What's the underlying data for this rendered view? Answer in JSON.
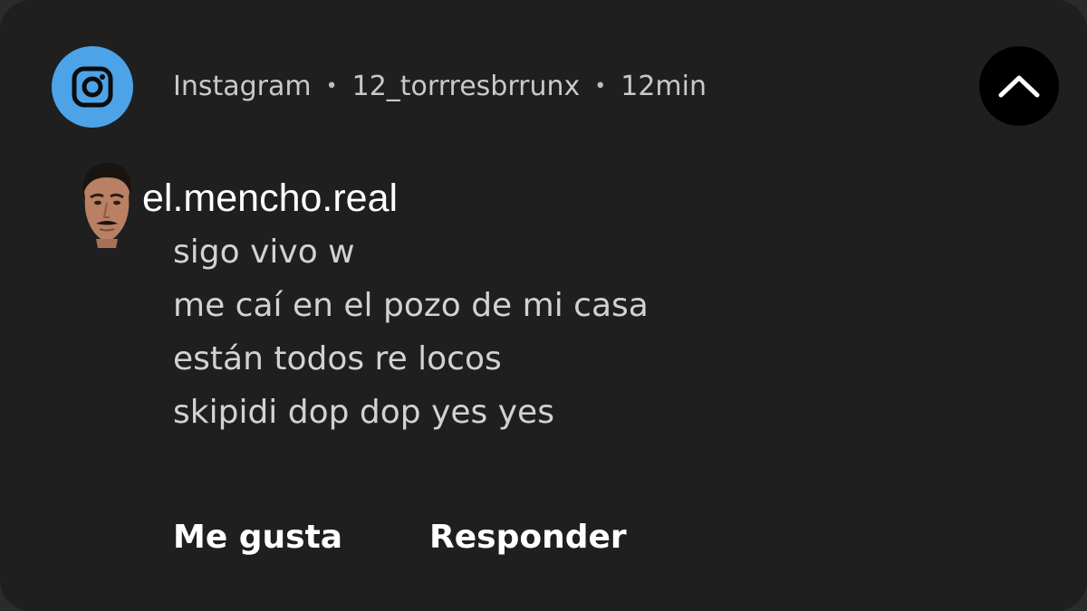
{
  "notification": {
    "app_icon": "instagram-icon",
    "app_name": "Instagram",
    "separator": "•",
    "account": "12_torrresbrrunx",
    "time": "12min",
    "collapse_icon": "chevron-up-icon",
    "sender": "el.mencho.real",
    "messages": [
      "sigo vivo w",
      "me caí en el pozo de mi casa",
      "están todos re locos",
      "skipidi dop dop yes yes"
    ],
    "actions": {
      "like_label": "Me gusta",
      "reply_label": "Responder"
    }
  },
  "colors": {
    "background": "#1f1f1f",
    "app_icon_bg": "#4da3e8",
    "collapse_bg": "#000000",
    "primary_text": "#ffffff",
    "secondary_text": "#c9c9c9"
  }
}
